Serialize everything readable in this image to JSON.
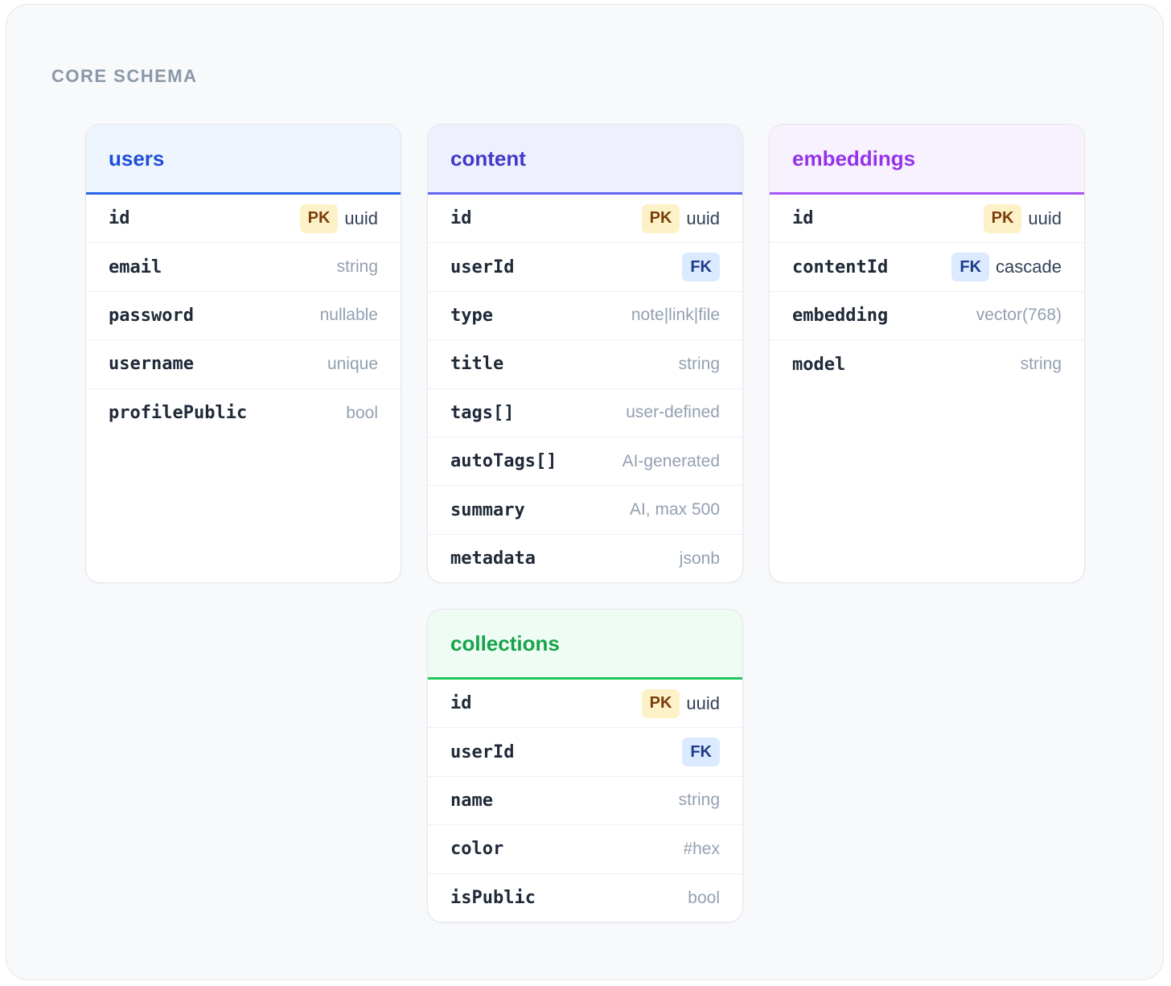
{
  "section_title": "CORE SCHEMA",
  "colors": {
    "users": {
      "title": "#1d4ed8",
      "header_bg": "#eef5ff",
      "accent": "#2563eb"
    },
    "content": {
      "title": "#4338ca",
      "header_bg": "#eef0fd",
      "accent": "#6366f1"
    },
    "embeddings": {
      "title": "#9333ea",
      "header_bg": "#f8f1fe",
      "accent": "#a855f7"
    },
    "collections": {
      "title": "#16a34a",
      "header_bg": "#effcf3",
      "accent": "#22c55e"
    }
  },
  "tables": {
    "users": {
      "title": "users",
      "rows": [
        {
          "field": "id",
          "badge": "PK",
          "type": "uuid"
        },
        {
          "field": "email",
          "note": "string"
        },
        {
          "field": "password",
          "note": "nullable"
        },
        {
          "field": "username",
          "note": "unique"
        },
        {
          "field": "profilePublic",
          "note": "bool"
        }
      ]
    },
    "content": {
      "title": "content",
      "rows": [
        {
          "field": "id",
          "badge": "PK",
          "type": "uuid"
        },
        {
          "field": "userId",
          "badge": "FK"
        },
        {
          "field": "type",
          "note": "note|link|file"
        },
        {
          "field": "title",
          "note": "string"
        },
        {
          "field": "tags[]",
          "note": "user-defined"
        },
        {
          "field": "autoTags[]",
          "note": "AI-generated"
        },
        {
          "field": "summary",
          "note": "AI, max 500"
        },
        {
          "field": "metadata",
          "note": "jsonb"
        }
      ]
    },
    "embeddings": {
      "title": "embeddings",
      "rows": [
        {
          "field": "id",
          "badge": "PK",
          "type": "uuid"
        },
        {
          "field": "contentId",
          "badge": "FK",
          "type": "cascade"
        },
        {
          "field": "embedding",
          "note": "vector(768)"
        },
        {
          "field": "model",
          "note": "string"
        }
      ]
    },
    "collections": {
      "title": "collections",
      "rows": [
        {
          "field": "id",
          "badge": "PK",
          "type": "uuid"
        },
        {
          "field": "userId",
          "badge": "FK"
        },
        {
          "field": "name",
          "note": "string"
        },
        {
          "field": "color",
          "note": "#hex"
        },
        {
          "field": "isPublic",
          "note": "bool"
        }
      ]
    }
  }
}
